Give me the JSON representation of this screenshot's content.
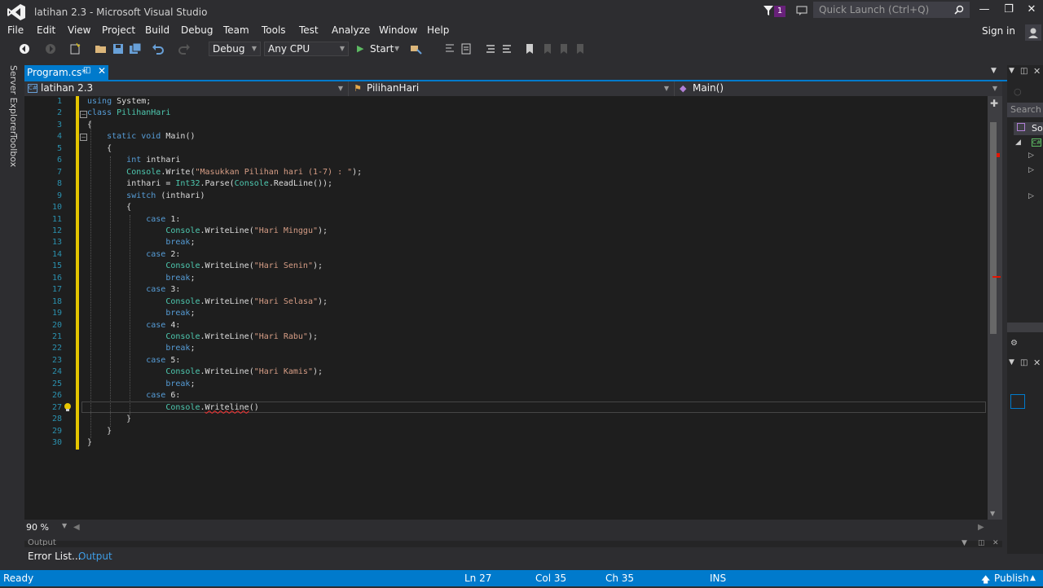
{
  "window": {
    "title": "latihan 2.3 - Microsoft Visual Studio",
    "notification_count": "1",
    "quick_launch_placeholder": "Quick Launch (Ctrl+Q)",
    "sign_in": "Sign in"
  },
  "menu": [
    "File",
    "Edit",
    "View",
    "Project",
    "Build",
    "Debug",
    "Team",
    "Tools",
    "Test",
    "Analyze",
    "Window",
    "Help"
  ],
  "toolbar": {
    "configuration": "Debug",
    "platform": "Any CPU",
    "start_label": "Start"
  },
  "left_strip": [
    "Server Explorer",
    "Toolbox"
  ],
  "tabs": {
    "active": "Program.cs*"
  },
  "navbar": {
    "project": "latihan 2.3",
    "class": "PilihanHari",
    "member": "Main()"
  },
  "editor": {
    "line_numbers": [
      "1",
      "2",
      "3",
      "4",
      "5",
      "6",
      "7",
      "8",
      "9",
      "10",
      "11",
      "12",
      "13",
      "14",
      "15",
      "16",
      "17",
      "18",
      "19",
      "20",
      "21",
      "22",
      "23",
      "24",
      "25",
      "26",
      "27",
      "28",
      "29",
      "30"
    ],
    "lines": [
      {
        "indent": "",
        "parts": [
          [
            "kw",
            "using"
          ],
          [
            "",
            " System;"
          ]
        ]
      },
      {
        "indent": "",
        "parts": [
          [
            "kw",
            "class"
          ],
          [
            "",
            " "
          ],
          [
            "ty",
            "PilihanHari"
          ]
        ]
      },
      {
        "indent": "",
        "parts": [
          [
            "",
            "{"
          ]
        ]
      },
      {
        "indent": "    ",
        "parts": [
          [
            "kw",
            "static"
          ],
          [
            "",
            " "
          ],
          [
            "kw",
            "void"
          ],
          [
            "",
            " Main()"
          ]
        ]
      },
      {
        "indent": "    ",
        "parts": [
          [
            "",
            "{"
          ]
        ]
      },
      {
        "indent": "        ",
        "parts": [
          [
            "kw",
            "int"
          ],
          [
            "",
            " inthari"
          ]
        ]
      },
      {
        "indent": "        ",
        "parts": [
          [
            "ty",
            "Console"
          ],
          [
            "",
            ".Write("
          ],
          [
            "str",
            "\"Masukkan Pilihan hari (1-7) : \""
          ],
          [
            "",
            ");"
          ]
        ]
      },
      {
        "indent": "        ",
        "parts": [
          [
            "",
            "inthari = "
          ],
          [
            "ty",
            "Int32"
          ],
          [
            "",
            ".Parse("
          ],
          [
            "ty",
            "Console"
          ],
          [
            "",
            ".ReadLine());"
          ]
        ]
      },
      {
        "indent": "        ",
        "parts": [
          [
            "kw",
            "switch"
          ],
          [
            "",
            " (inthari)"
          ]
        ]
      },
      {
        "indent": "        ",
        "parts": [
          [
            "",
            "{"
          ]
        ]
      },
      {
        "indent": "            ",
        "parts": [
          [
            "kw",
            "case"
          ],
          [
            "",
            " 1:"
          ]
        ]
      },
      {
        "indent": "                ",
        "parts": [
          [
            "ty",
            "Console"
          ],
          [
            "",
            ".WriteLine("
          ],
          [
            "str",
            "\"Hari Minggu\""
          ],
          [
            "",
            ");"
          ]
        ]
      },
      {
        "indent": "                ",
        "parts": [
          [
            "kw",
            "break"
          ],
          [
            "",
            ";"
          ]
        ]
      },
      {
        "indent": "            ",
        "parts": [
          [
            "kw",
            "case"
          ],
          [
            "",
            " 2:"
          ]
        ]
      },
      {
        "indent": "                ",
        "parts": [
          [
            "ty",
            "Console"
          ],
          [
            "",
            ".WriteLine("
          ],
          [
            "str",
            "\"Hari Senin\""
          ],
          [
            "",
            ");"
          ]
        ]
      },
      {
        "indent": "                ",
        "parts": [
          [
            "kw",
            "break"
          ],
          [
            "",
            ";"
          ]
        ]
      },
      {
        "indent": "            ",
        "parts": [
          [
            "kw",
            "case"
          ],
          [
            "",
            " 3:"
          ]
        ]
      },
      {
        "indent": "                ",
        "parts": [
          [
            "ty",
            "Console"
          ],
          [
            "",
            ".WriteLine("
          ],
          [
            "str",
            "\"Hari Selasa\""
          ],
          [
            "",
            ");"
          ]
        ]
      },
      {
        "indent": "                ",
        "parts": [
          [
            "kw",
            "break"
          ],
          [
            "",
            ";"
          ]
        ]
      },
      {
        "indent": "            ",
        "parts": [
          [
            "kw",
            "case"
          ],
          [
            "",
            " 4:"
          ]
        ]
      },
      {
        "indent": "                ",
        "parts": [
          [
            "ty",
            "Console"
          ],
          [
            "",
            ".WriteLine("
          ],
          [
            "str",
            "\"Hari Rabu\""
          ],
          [
            "",
            ");"
          ]
        ]
      },
      {
        "indent": "                ",
        "parts": [
          [
            "kw",
            "break"
          ],
          [
            "",
            ";"
          ]
        ]
      },
      {
        "indent": "            ",
        "parts": [
          [
            "kw",
            "case"
          ],
          [
            "",
            " 5:"
          ]
        ]
      },
      {
        "indent": "                ",
        "parts": [
          [
            "ty",
            "Console"
          ],
          [
            "",
            ".WriteLine("
          ],
          [
            "str",
            "\"Hari Kamis\""
          ],
          [
            "",
            ");"
          ]
        ]
      },
      {
        "indent": "                ",
        "parts": [
          [
            "kw",
            "break"
          ],
          [
            "",
            ";"
          ]
        ]
      },
      {
        "indent": "            ",
        "parts": [
          [
            "kw",
            "case"
          ],
          [
            "",
            " 6:"
          ]
        ]
      },
      {
        "indent": "                ",
        "parts": [
          [
            "ty",
            "Console"
          ],
          [
            "",
            "."
          ],
          [
            "err",
            "Writeline"
          ],
          [
            "",
            "()"
          ]
        ]
      },
      {
        "indent": "        ",
        "parts": [
          [
            "",
            "}"
          ]
        ]
      },
      {
        "indent": "    ",
        "parts": [
          [
            "",
            "}"
          ]
        ]
      },
      {
        "indent": "",
        "parts": [
          [
            "",
            "}"
          ]
        ]
      }
    ]
  },
  "zoom": "90 %",
  "bottom_tabs": {
    "error_list": "Error List...",
    "output": "Output",
    "output_header": "Output"
  },
  "right_panel": {
    "search": "Search S",
    "solution": "So"
  },
  "status": {
    "ready": "Ready",
    "ln": "Ln 27",
    "col": "Col 35",
    "ch": "Ch 35",
    "ins": "INS",
    "publish": "Publish"
  },
  "colors": {
    "accent": "#007acc",
    "keyword": "#569cd6",
    "type": "#4ec9b0",
    "string": "#d69d85",
    "line_number": "#2b91af",
    "change_bar": "#e5c500"
  }
}
